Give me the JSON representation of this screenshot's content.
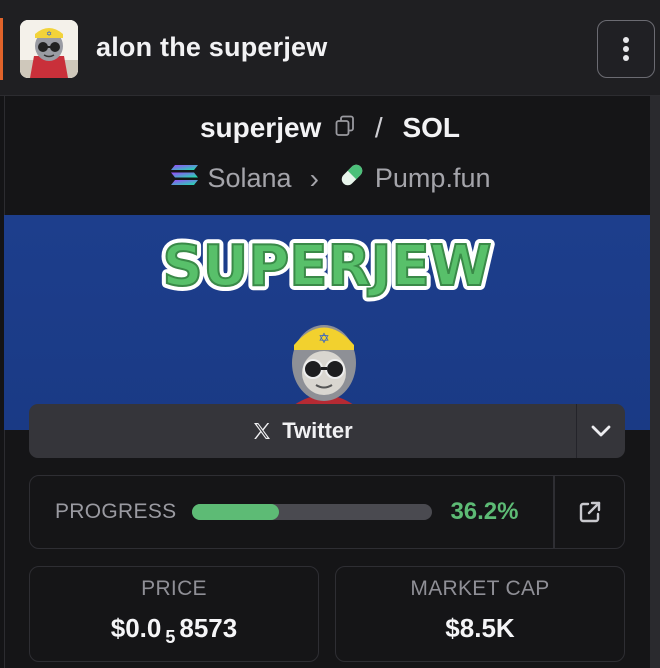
{
  "header": {
    "title": "alon the superjew",
    "menu_icon": "kebab-vertical-icon",
    "accent_color": "#e0632a"
  },
  "pair": {
    "base": "superjew",
    "separator": "/",
    "quote": "SOL"
  },
  "chain": {
    "network": "Solana",
    "chevron": "›",
    "dex": "Pump.fun"
  },
  "banner": {
    "text": "SUPERJEW"
  },
  "twitter": {
    "label": "Twitter",
    "icon": "x-logo-icon"
  },
  "progress": {
    "label": "PROGRESS",
    "percent": 36.2,
    "value_text": "36.2%",
    "color": "#5dbb75"
  },
  "price": {
    "label": "PRICE",
    "prefix": "$0.0",
    "zeros": "5",
    "digits": "8573"
  },
  "market_cap": {
    "label": "MARKET CAP",
    "value": "$8.5K"
  }
}
